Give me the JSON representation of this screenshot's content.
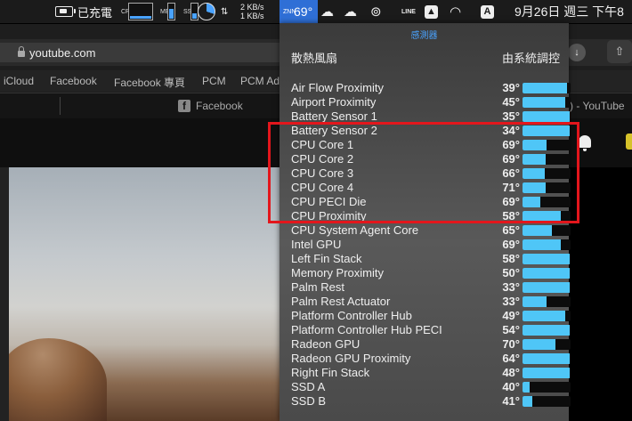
{
  "menubar": {
    "battery_label": "已充電",
    "cpu_label": "CPU",
    "mem_label": "MEM",
    "ssd_label": "SSD",
    "net_up": "2 KB/s",
    "net_down": "1 KB/s",
    "temp_label": "ZNN",
    "temp_value": "69°",
    "line_label": "LINE",
    "input_source": "A",
    "clock": "9月26日 週三 下午8"
  },
  "browser": {
    "url": "youtube.com",
    "bookmarks": [
      "iCloud",
      "Facebook",
      "Facebook 專頁",
      "PCM",
      "PCM Ad"
    ],
    "tab_facebook": "Facebook",
    "tab_youtube": ") - YouTube"
  },
  "panel": {
    "tab_title": "感測器",
    "fan_label": "散熱風扇",
    "fan_value": "由系統調控",
    "sensors": [
      {
        "name": "Air Flow Proximity",
        "value": "39°",
        "level": 0.92
      },
      {
        "name": "Airport Proximity",
        "value": "45°",
        "level": 0.88
      },
      {
        "name": "Battery Sensor 1",
        "value": "35°",
        "level": 0.98
      },
      {
        "name": "Battery Sensor 2",
        "value": "34°",
        "level": 0.98
      },
      {
        "name": "CPU Core 1",
        "value": "69°",
        "level": 0.5
      },
      {
        "name": "CPU Core 2",
        "value": "69°",
        "level": 0.48
      },
      {
        "name": "CPU Core 3",
        "value": "66°",
        "level": 0.46
      },
      {
        "name": "CPU Core 4",
        "value": "71°",
        "level": 0.48
      },
      {
        "name": "CPU PECI Die",
        "value": "69°",
        "level": 0.37
      },
      {
        "name": "CPU Proximity",
        "value": "58°",
        "level": 0.8
      },
      {
        "name": "CPU System Agent Core",
        "value": "65°",
        "level": 0.62
      },
      {
        "name": "Intel GPU",
        "value": "69°",
        "level": 0.8
      },
      {
        "name": "Left Fin Stack",
        "value": "58°",
        "level": 0.98
      },
      {
        "name": "Memory Proximity",
        "value": "50°",
        "level": 0.98
      },
      {
        "name": "Palm Rest",
        "value": "33°",
        "level": 0.98
      },
      {
        "name": "Palm Rest Actuator",
        "value": "33°",
        "level": 0.5
      },
      {
        "name": "Platform Controller Hub",
        "value": "49°",
        "level": 0.88
      },
      {
        "name": "Platform Controller Hub PECI",
        "value": "54°",
        "level": 0.98
      },
      {
        "name": "Radeon GPU",
        "value": "70°",
        "level": 0.68
      },
      {
        "name": "Radeon GPU Proximity",
        "value": "64°",
        "level": 0.98
      },
      {
        "name": "Right Fin Stack",
        "value": "48°",
        "level": 0.98
      },
      {
        "name": "SSD A",
        "value": "40°",
        "level": 0.14
      },
      {
        "name": "SSD B",
        "value": "41°",
        "level": 0.2
      }
    ]
  },
  "colors": {
    "accent": "#2f6fd6",
    "bar_fill": "#4fc6f7",
    "highlight_box": "#e3161c"
  }
}
